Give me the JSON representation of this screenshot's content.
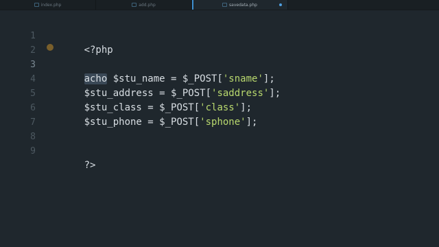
{
  "tabs": [
    {
      "label": "index.php"
    },
    {
      "label": "add.php"
    },
    {
      "label": "savedata.php"
    }
  ],
  "gutter": [
    "1",
    "2",
    "3",
    "4",
    "5",
    "6",
    "7",
    "8",
    "9"
  ],
  "code": {
    "l1": "<?php",
    "l3_kw": "acho",
    "l3_var": " $stu_name = $_POST[",
    "l3_str": "'sname'",
    "l3_end": "];",
    "l4_var": "$stu_address = $_POST[",
    "l4_str": "'saddress'",
    "l4_end": "];",
    "l5_var": "$stu_class = $_POST[",
    "l5_str": "'class'",
    "l5_end": "];",
    "l6_var": "$stu_phone = $_POST[",
    "l6_str": "'sphone'",
    "l6_end": "];",
    "l9": "?>"
  },
  "colors": {
    "background": "#1f272d",
    "string": "#b9d96e",
    "selection": "#3a4856",
    "active_tab_accent": "#3e8fd0"
  }
}
